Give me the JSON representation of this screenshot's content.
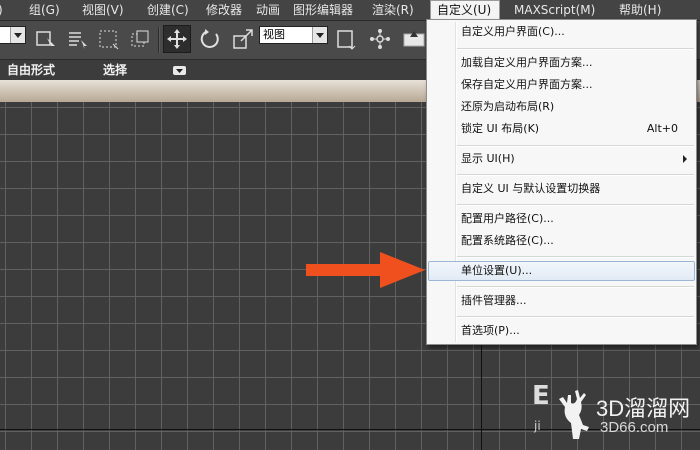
{
  "menubar": {
    "items": [
      {
        "label": "组(G)"
      },
      {
        "label": "视图(V)"
      },
      {
        "label": "创建(C)"
      },
      {
        "label": "修改器"
      },
      {
        "label": "动画"
      },
      {
        "label": "图形编辑器"
      },
      {
        "label": "渲染(R)"
      },
      {
        "label": "自定义(U)"
      },
      {
        "label": "MAXScript(M)"
      },
      {
        "label": "帮助(H)"
      }
    ]
  },
  "toolbar": {
    "view_combo": "视图"
  },
  "ribbon": {
    "freeform_label": "自由形式",
    "select_label": "选择"
  },
  "dropdown": {
    "items": [
      {
        "label": "自定义用户界面(C)..."
      },
      {
        "label": "加载自定义用户界面方案..."
      },
      {
        "label": "保存自定义用户界面方案..."
      },
      {
        "label": "还原为启动布局(R)"
      },
      {
        "label": "锁定 UI 布局(K)",
        "shortcut": "Alt+0"
      },
      {
        "label": "显示 UI(H)"
      },
      {
        "label": "自定义 UI 与默认设置切换器"
      },
      {
        "label": "配置用户路径(C)..."
      },
      {
        "label": "配置系统路径(C)..."
      },
      {
        "label": "单位设置(U)..."
      },
      {
        "label": "插件管理器..."
      },
      {
        "label": "首选项(P)..."
      }
    ]
  },
  "watermark": {
    "brand": "3D溜溜网",
    "url": "3D66.com",
    "partial": "E",
    "partial2": "ji"
  },
  "colors": {
    "annotation_arrow": "#f0501e",
    "menu_highlight": "#dfe9f5",
    "viewport_bg": "#3c3c3c"
  }
}
